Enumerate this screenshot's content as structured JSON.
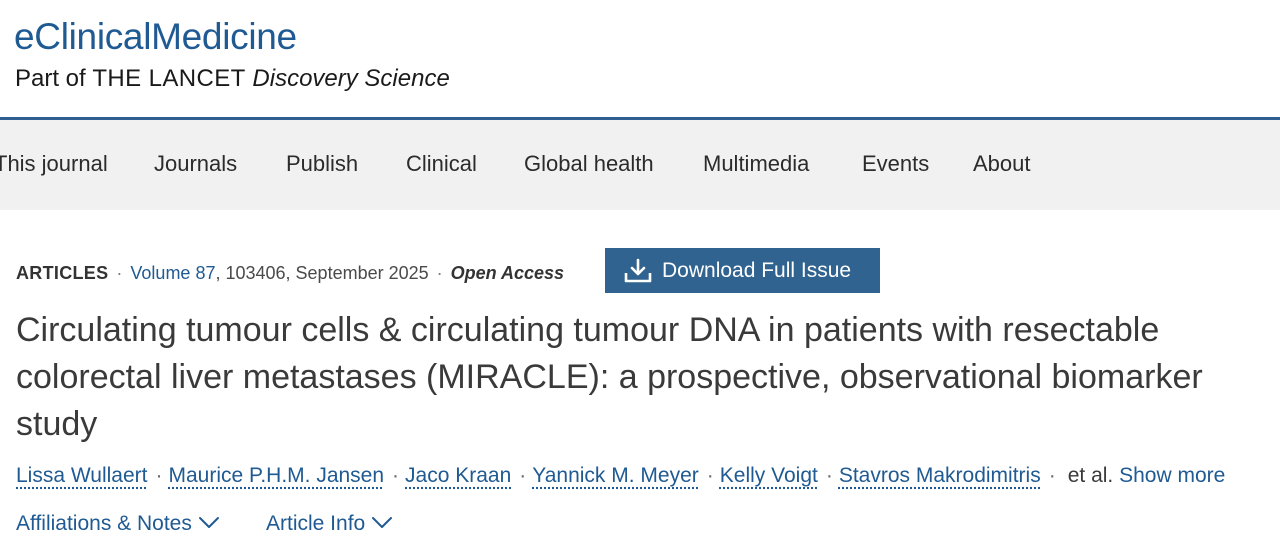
{
  "header": {
    "journal_title": "eClinicalMedicine",
    "subtitle_prefix": "Part of",
    "subtitle_brand": "THE LANCET",
    "subtitle_discovery": "Discovery Science"
  },
  "nav": {
    "items": [
      {
        "label": "This journal"
      },
      {
        "label": "Journals"
      },
      {
        "label": "Publish"
      },
      {
        "label": "Clinical"
      },
      {
        "label": "Global health"
      },
      {
        "label": "Multimedia"
      },
      {
        "label": "Events"
      },
      {
        "label": "About"
      }
    ]
  },
  "article": {
    "type": "ARTICLES",
    "volume_link": "Volume 87",
    "citation": ", 103406, September 2025",
    "access": "Open Access",
    "download_label": "Download Full Issue",
    "download_icon": "download-icon",
    "title": "Circulating tumour cells & circulating tumour DNA in patients with resectable colorectal liver metastases (MIRACLE): a prospective, observational biomarker study",
    "separator": "·",
    "authors": [
      "Lissa Wullaert",
      "Maurice P.H.M. Jansen",
      "Jaco Kraan",
      "Yannick M. Meyer",
      "Kelly Voigt",
      "Stavros Makrodimitris"
    ],
    "et_al": "et al.",
    "show_more": "Show more",
    "affiliations_label": "Affiliations & Notes",
    "article_info_label": "Article Info",
    "chevron_icon": "chevron-down-icon"
  },
  "colors": {
    "brand_blue": "#1f5a92",
    "button_blue": "#30638f",
    "nav_bg": "#f1f1f1",
    "header_rule": "#2d5f90"
  }
}
